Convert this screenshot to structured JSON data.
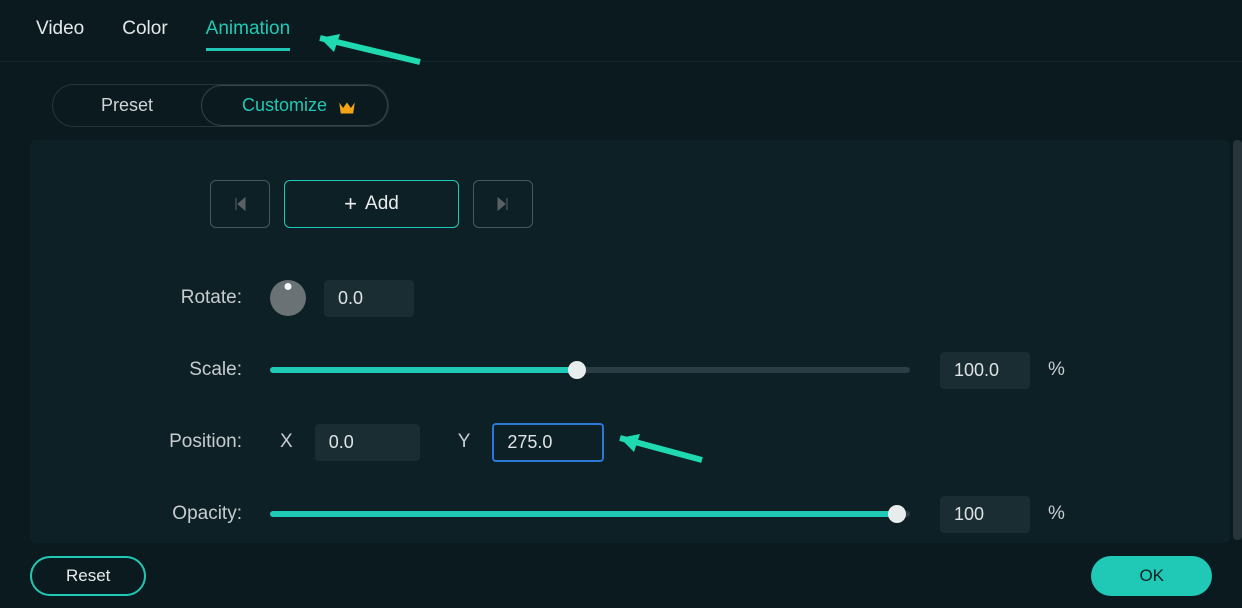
{
  "tabs": {
    "video": "Video",
    "color": "Color",
    "animation": "Animation"
  },
  "subtabs": {
    "preset": "Preset",
    "customize": "Customize"
  },
  "keyframe": {
    "add": "Add"
  },
  "props": {
    "rotate_label": "Rotate:",
    "rotate_value": "0.0",
    "scale_label": "Scale:",
    "scale_value": "100.0",
    "scale_pct": 48,
    "position_label": "Position:",
    "x_label": "X",
    "x_value": "0.0",
    "y_label": "Y",
    "y_value": "275.0",
    "opacity_label": "Opacity:",
    "opacity_value": "100",
    "opacity_pct": 98,
    "unit": "%"
  },
  "footer": {
    "reset": "Reset",
    "ok": "OK"
  }
}
